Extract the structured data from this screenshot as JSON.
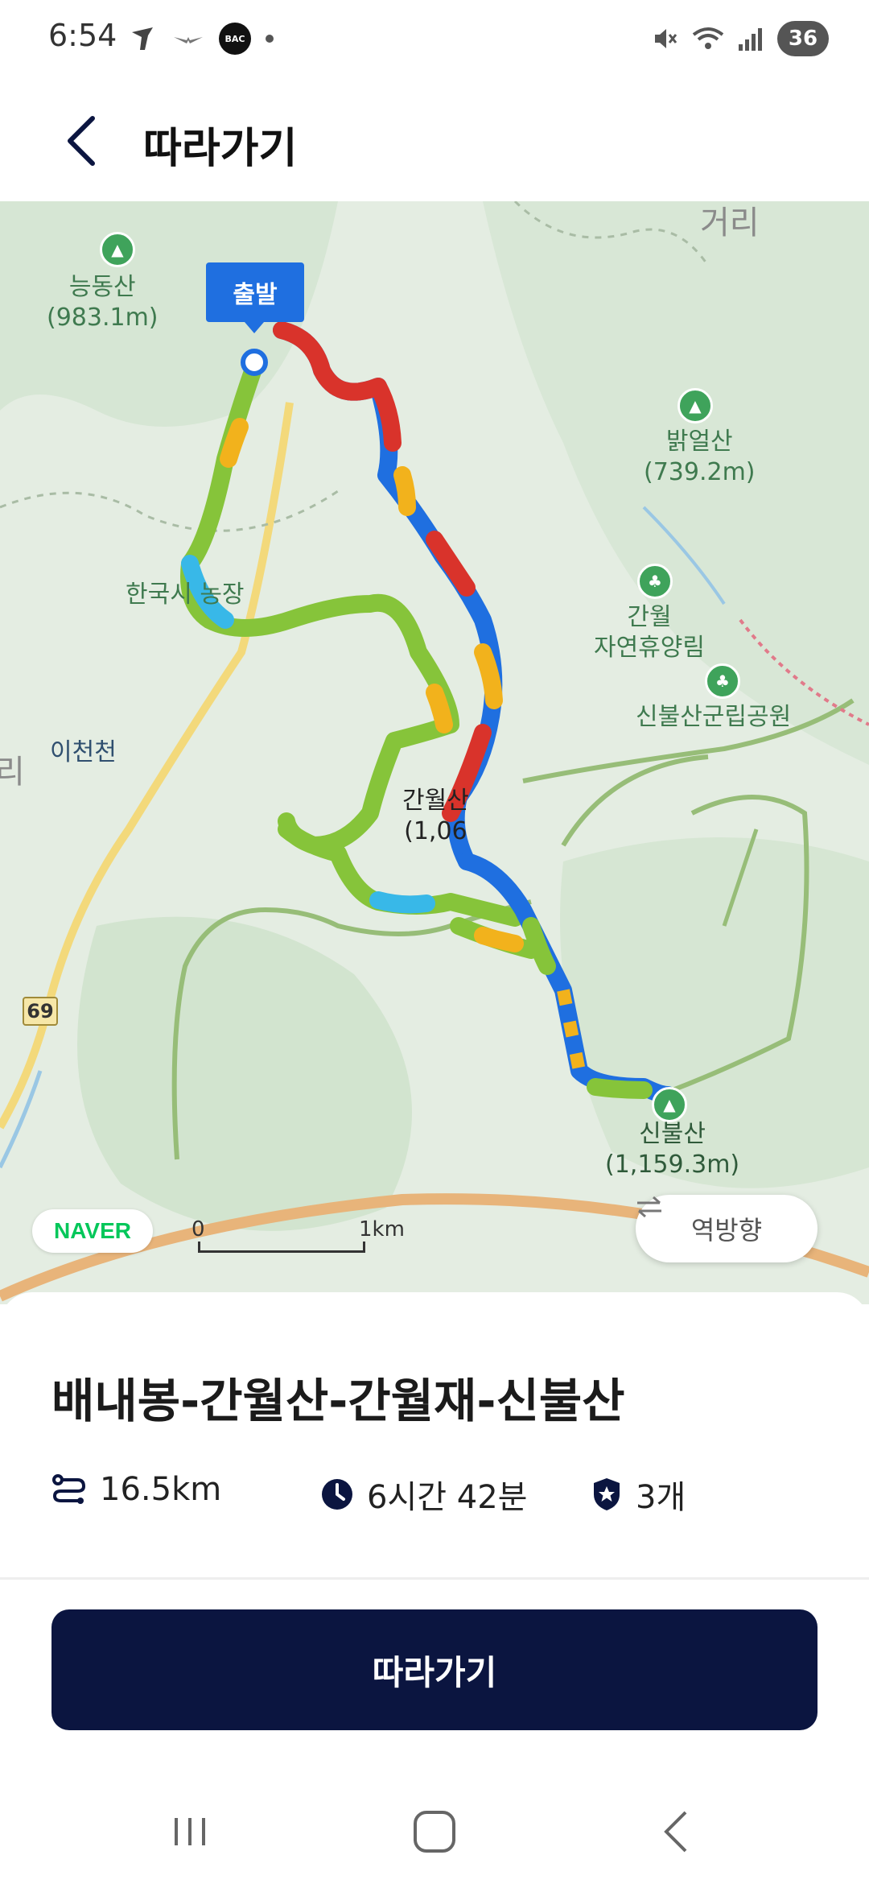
{
  "status_bar": {
    "time": "6:54",
    "badge": "BAC",
    "battery": "36"
  },
  "header": {
    "title": "따라가기"
  },
  "map": {
    "start_flag": "출발",
    "labels": {
      "geori": "거리",
      "neungdongsan_name": "능동산",
      "neungdongsan_height": "(983.1m)",
      "bakeolsan_name": "밝얼산",
      "bakeolsan_height": "(739.2m)",
      "farm": "한국시   농장",
      "ganwol_forest_1": "간월",
      "ganwol_forest_2": "자연휴양림",
      "sinbul_park": "신불산군립공원",
      "icheoncheon": "이천천",
      "ganwolsan_name": "간월산",
      "ganwolsan_height": "(1,06",
      "sinbulsan_name": "신불산",
      "sinbulsan_height": "(1,159.3m)",
      "edge_left": "리"
    },
    "road_number": "69",
    "logo": "NAVER",
    "scale_start": "0",
    "scale_end": "1km",
    "reverse_button": "역방향",
    "colors": {
      "track_green": "#86c43a",
      "track_yellow": "#f2b21c",
      "track_red": "#d9332b",
      "track_blue": "#1f6fe0",
      "track_cyan": "#38b8e8"
    }
  },
  "route": {
    "title": "배내봉-간월산-간월재-신불산",
    "distance": "16.5km",
    "duration": "6시간 42분",
    "count": "3개",
    "follow_button": "따라가기"
  },
  "nav_bar": {
    "icons": [
      "recent-apps-icon",
      "home-icon",
      "back-icon"
    ]
  }
}
